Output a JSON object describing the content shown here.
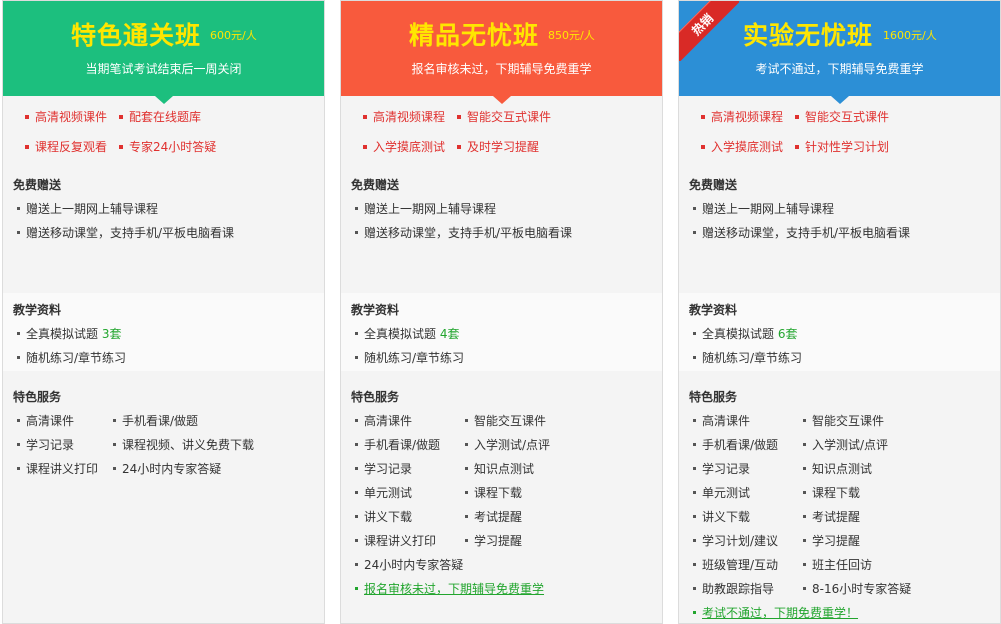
{
  "plans": [
    {
      "title": "特色通关班",
      "price": "600元/人",
      "subtitle": "当期笔试考试结束后一周关闭",
      "header_color": "#1cbf7e",
      "title_color": "#ffe600",
      "price_color": "#ffe600",
      "hot_badge": "",
      "highlights": [
        "高清视频课件",
        "配套在线题库",
        "课程反复观看",
        "专家24小时答疑"
      ],
      "free_gift_title": "免费赠送",
      "free_gifts": [
        "赠送上一期网上辅导课程",
        "赠送移动课堂，支持手机/平板电脑看课"
      ],
      "materials_title": "教学资料",
      "materials_exam_prefix": "全真模拟试题",
      "materials_exam_count": "3套",
      "materials_practice": "随机练习/章节练习",
      "services_title": "特色服务",
      "services_left": [
        "高清课件",
        "学习记录",
        "课程讲义打印"
      ],
      "services_right": [
        "手机看课/做题",
        "课程视频、讲义免费下载",
        "24小时内专家答疑"
      ],
      "services_bottom": "",
      "services_link": ""
    },
    {
      "title": "精品无忧班",
      "price": "850元/人",
      "subtitle": "报名审核未过，下期辅导免费重学",
      "header_color": "#f85a3d",
      "title_color": "#ffe600",
      "price_color": "#ffe600",
      "hot_badge": "",
      "highlights": [
        "高清视频课程",
        "智能交互式课件",
        "入学摸底测试",
        "及时学习提醒"
      ],
      "free_gift_title": "免费赠送",
      "free_gifts": [
        "赠送上一期网上辅导课程",
        "赠送移动课堂，支持手机/平板电脑看课"
      ],
      "materials_title": "教学资料",
      "materials_exam_prefix": "全真模拟试题",
      "materials_exam_count": "4套",
      "materials_practice": "随机练习/章节练习",
      "services_title": "特色服务",
      "services_left": [
        "高清课件",
        "手机看课/做题",
        "学习记录",
        "单元测试",
        "讲义下载",
        "课程讲义打印"
      ],
      "services_right": [
        "智能交互课件",
        "入学测试/点评",
        "知识点测试",
        "课程下载",
        "考试提醒",
        "学习提醒"
      ],
      "services_bottom": "24小时内专家答疑",
      "services_link": "报名审核未过，下期辅导免费重学"
    },
    {
      "title": "实验无忧班",
      "price": "1600元/人",
      "subtitle": "考试不通过，下期辅导免费重学",
      "header_color": "#2c8fd6",
      "title_color": "#ffe600",
      "price_color": "#ffe600",
      "hot_badge": "热销",
      "highlights": [
        "高清视频课程",
        "智能交互式课件",
        "入学摸底测试",
        "针对性学习计划"
      ],
      "free_gift_title": "免费赠送",
      "free_gifts": [
        "赠送上一期网上辅导课程",
        "赠送移动课堂，支持手机/平板电脑看课"
      ],
      "materials_title": "教学资料",
      "materials_exam_prefix": "全真模拟试题",
      "materials_exam_count": "6套",
      "materials_practice": "随机练习/章节练习",
      "services_title": "特色服务",
      "services_left": [
        "高清课件",
        "手机看课/做题",
        "学习记录",
        "单元测试",
        "讲义下载",
        "学习计划/建议",
        "班级管理/互动",
        "助教跟踪指导"
      ],
      "services_right": [
        "智能交互课件",
        "入学测试/点评",
        "知识点测试",
        "课程下载",
        "考试提醒",
        "学习提醒",
        "班主任回访",
        "8-16小时专家答疑"
      ],
      "services_bottom": "",
      "services_link": "考试不通过，下期免费重学！"
    }
  ]
}
